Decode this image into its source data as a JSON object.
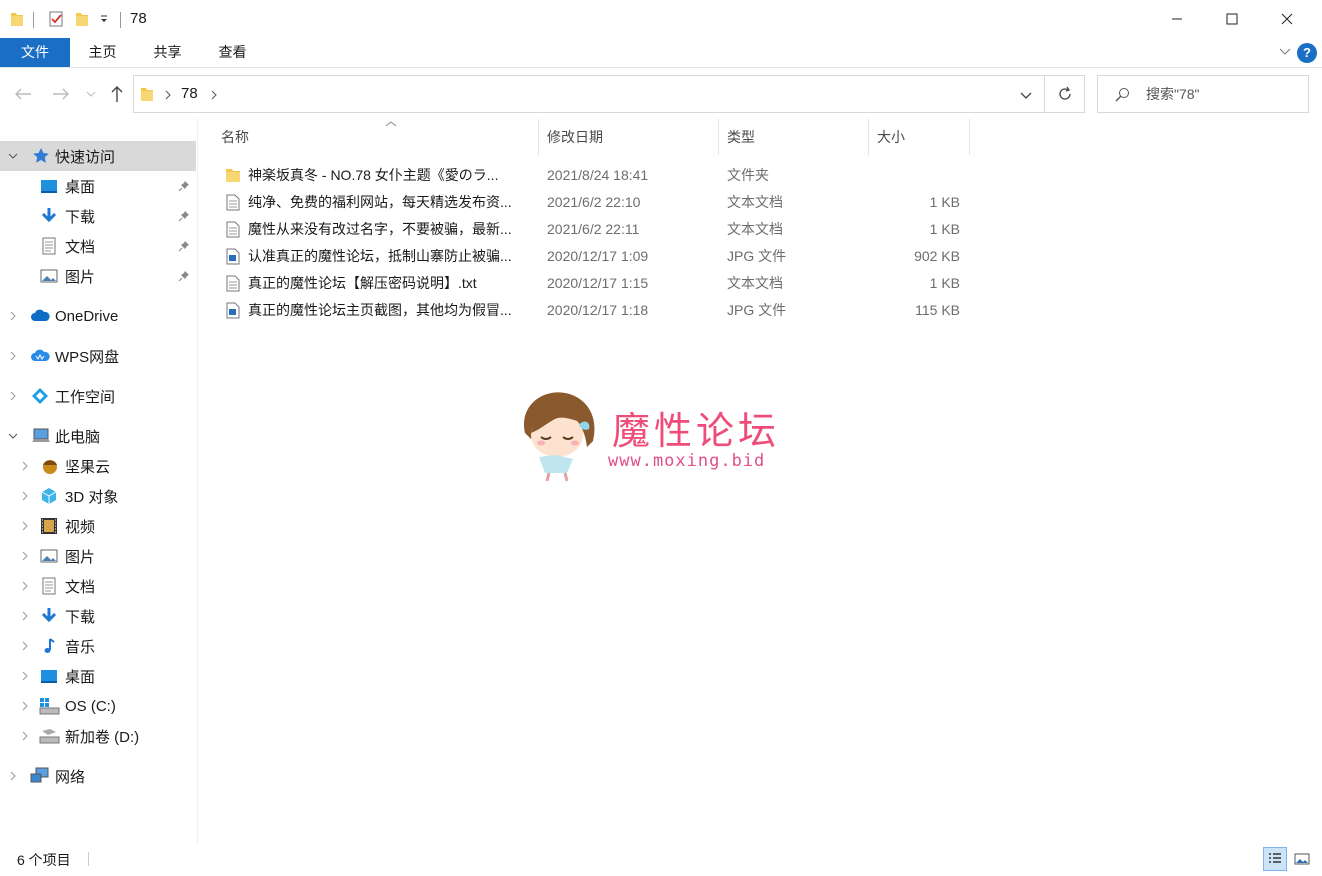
{
  "window": {
    "title": "78"
  },
  "ribbon": {
    "tabs": [
      "文件",
      "主页",
      "共享",
      "查看"
    ]
  },
  "address": {
    "path": "78",
    "search_placeholder": "搜索\"78\""
  },
  "sidebar": {
    "quick_access": "快速访问",
    "quick_items": [
      "桌面",
      "下载",
      "文档",
      "图片"
    ],
    "onedrive": "OneDrive",
    "wps": "WPS网盘",
    "workspace": "工作空间",
    "this_pc": "此电脑",
    "pc_items": [
      "坚果云",
      "3D 对象",
      "视频",
      "图片",
      "文档",
      "下载",
      "音乐",
      "桌面",
      "OS (C:)",
      "新加卷 (D:)"
    ],
    "network": "网络"
  },
  "columns": {
    "name": "名称",
    "date": "修改日期",
    "type": "类型",
    "size": "大小"
  },
  "files": [
    {
      "name": "神楽坂真冬 - NO.78 女仆主题《愛のラ...",
      "date": "2021/8/24 18:41",
      "type": "文件夹",
      "size": "",
      "icon": "folder-icon"
    },
    {
      "name": "纯净、免费的福利网站，每天精选发布资...",
      "date": "2021/6/2 22:10",
      "type": "文本文档",
      "size": "1 KB",
      "icon": "text-file-icon"
    },
    {
      "name": "魔性从来没有改过名字，不要被骗，最新...",
      "date": "2021/6/2 22:11",
      "type": "文本文档",
      "size": "1 KB",
      "icon": "text-file-icon"
    },
    {
      "name": "认准真正的魔性论坛，抵制山寨防止被骗...",
      "date": "2020/12/17 1:09",
      "type": "JPG 文件",
      "size": "902 KB",
      "icon": "image-file-icon"
    },
    {
      "name": "真正的魔性论坛【解压密码说明】.txt",
      "date": "2020/12/17 1:15",
      "type": "文本文档",
      "size": "1 KB",
      "icon": "text-file-icon"
    },
    {
      "name": "真正的魔性论坛主页截图，其他均为假冒...",
      "date": "2020/12/17 1:18",
      "type": "JPG 文件",
      "size": "115 KB",
      "icon": "image-file-icon"
    }
  ],
  "watermark": {
    "title": "魔性论坛",
    "url": "www.moxing.bid"
  },
  "status": {
    "count": "6 个项目"
  },
  "colors": {
    "accent": "#1a6fc4",
    "selected": "#d9d9d9",
    "watermark": "#ee4d7a"
  }
}
